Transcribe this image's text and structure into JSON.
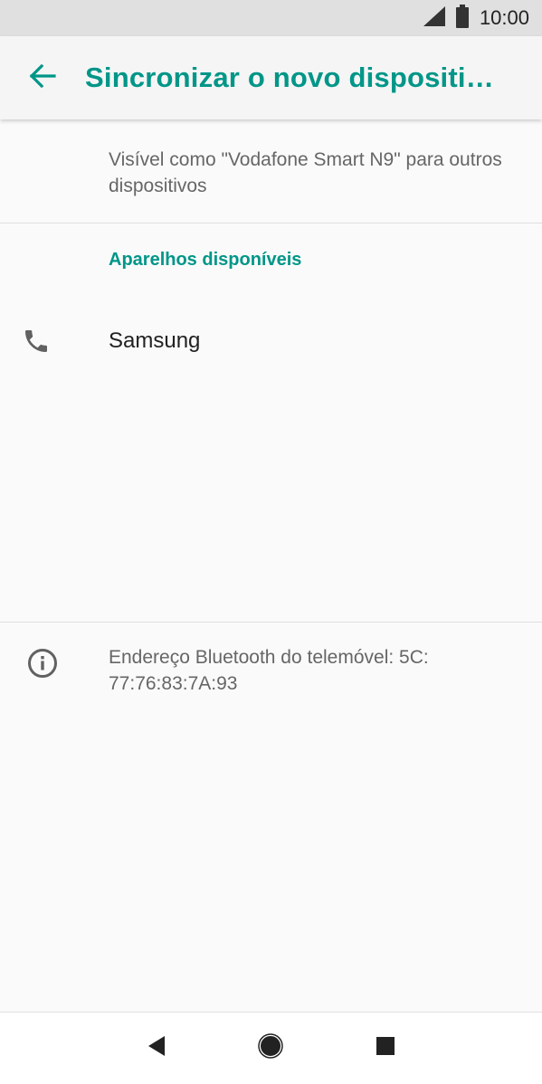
{
  "status_bar": {
    "time": "10:00"
  },
  "app_bar": {
    "title": "Sincronizar o novo dispositi…"
  },
  "visibility": {
    "text": "Visível como \"Vodafone Smart N9\" para outros dispositivos"
  },
  "available": {
    "header": "Aparelhos disponíveis",
    "devices": [
      {
        "name": "Samsung",
        "icon": "phone-icon"
      }
    ]
  },
  "bluetooth": {
    "address_text": "Endereço Bluetooth do telemóvel: 5C: 77:76:83:7A:93"
  },
  "colors": {
    "accent": "#009688",
    "text_secondary": "#666666",
    "background": "#fafafa"
  }
}
